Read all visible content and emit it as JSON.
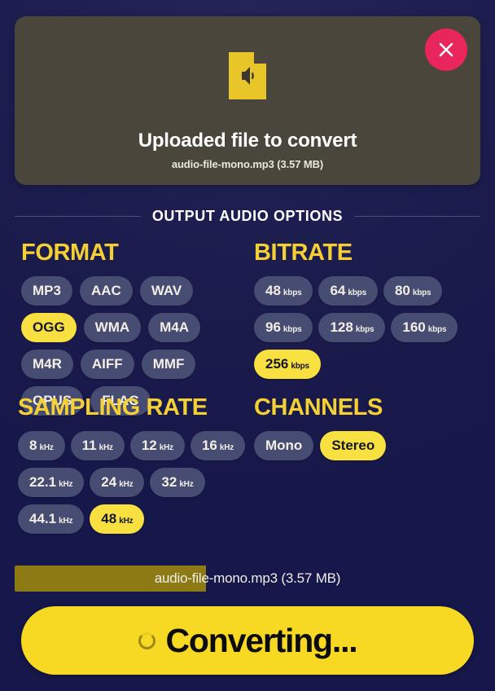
{
  "upload_card": {
    "icon": "audio-file-icon",
    "close_icon": "close-icon",
    "title": "Uploaded file to convert",
    "filename": "audio-file-mono.mp3 (3.57 MB)"
  },
  "options_header": {
    "title": "OUTPUT AUDIO OPTIONS"
  },
  "groups": [
    {
      "id": "format",
      "title": "FORMAT",
      "selected": "OGG",
      "chips": [
        {
          "value": "MP3",
          "unit": ""
        },
        {
          "value": "AAC",
          "unit": ""
        },
        {
          "value": "WAV",
          "unit": ""
        },
        {
          "value": "OGG",
          "unit": ""
        },
        {
          "value": "WMA",
          "unit": ""
        },
        {
          "value": "M4A",
          "unit": ""
        },
        {
          "value": "M4R",
          "unit": ""
        },
        {
          "value": "AIFF",
          "unit": ""
        },
        {
          "value": "MMF",
          "unit": ""
        },
        {
          "value": "OPUS",
          "unit": ""
        },
        {
          "value": "FLAC",
          "unit": ""
        }
      ]
    },
    {
      "id": "bitrate",
      "title": "BITRATE",
      "selected": "256",
      "chips": [
        {
          "value": "48",
          "unit": "kbps"
        },
        {
          "value": "64",
          "unit": "kbps"
        },
        {
          "value": "80",
          "unit": "kbps"
        },
        {
          "value": "96",
          "unit": "kbps"
        },
        {
          "value": "128",
          "unit": "kbps"
        },
        {
          "value": "160",
          "unit": "kbps"
        },
        {
          "value": "256",
          "unit": "kbps"
        }
      ]
    },
    {
      "id": "sampling",
      "title": "SAMPLING RATE",
      "selected": "48",
      "chips": [
        {
          "value": "8",
          "unit": "kHz"
        },
        {
          "value": "11",
          "unit": "kHz"
        },
        {
          "value": "12",
          "unit": "kHz"
        },
        {
          "value": "16",
          "unit": "kHz"
        },
        {
          "value": "22.1",
          "unit": "kHz"
        },
        {
          "value": "24",
          "unit": "kHz"
        },
        {
          "value": "32",
          "unit": "kHz"
        },
        {
          "value": "44.1",
          "unit": "kHz"
        },
        {
          "value": "48",
          "unit": "kHz"
        }
      ]
    },
    {
      "id": "channels",
      "title": "CHANNELS",
      "selected": "Stereo",
      "chips": [
        {
          "value": "Mono",
          "unit": ""
        },
        {
          "value": "Stereo",
          "unit": ""
        }
      ]
    }
  ],
  "progress": {
    "label": "audio-file-mono.mp3 (3.57 MB)",
    "percent": 41
  },
  "action": {
    "label": "Converting...",
    "icon": "spinner-icon"
  },
  "colors": {
    "background": "#1a1b4b",
    "accent_yellow": "#f7d823",
    "heading_yellow": "#f5d034",
    "chip_bg": "#474c72",
    "chip_selected": "#f7e03f",
    "card_bg": "#4a463c",
    "close_pink": "#e8255c",
    "progress_fill": "#8e7a14"
  }
}
